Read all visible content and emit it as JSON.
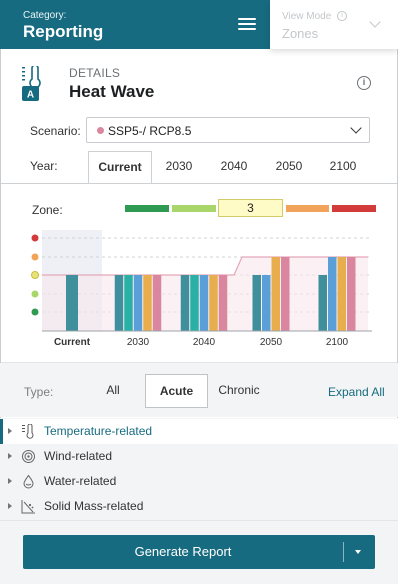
{
  "header": {
    "category_label": "Category:",
    "title": "Reporting",
    "view_mode_label": "View Mode",
    "view_mode_value": "Zones"
  },
  "details": {
    "label": "DETAILS",
    "title": "Heat Wave",
    "icon": "thermometer-icon"
  },
  "scenario": {
    "label": "Scenario:",
    "value": "SSP5-/ RCP8.5",
    "dot_color": "#d9869e"
  },
  "year": {
    "label": "Year:",
    "tabs": [
      "Current",
      "2030",
      "2040",
      "2050",
      "2100"
    ],
    "selected": "Current"
  },
  "zone": {
    "label": "Zone:",
    "value": "3",
    "colors": [
      "#2e9a52",
      "#a9d66a",
      "#fffbc7",
      "#f2a35a",
      "#d33a3a"
    ]
  },
  "chart_data": {
    "type": "bar",
    "categories": [
      "Current",
      "2030",
      "2040",
      "2050",
      "2100"
    ],
    "y_levels": [
      "#d33a3a",
      "#f2a35a",
      "#e8e27a",
      "#a9d66a",
      "#2e9a52"
    ],
    "series": [
      {
        "color": "#3f8f9c",
        "values": [
          3,
          3,
          3,
          3,
          3
        ]
      },
      {
        "color": "#2bb0a6",
        "values": [
          null,
          3,
          3,
          null,
          null
        ]
      },
      {
        "color": "#5b9fd8",
        "values": [
          null,
          3,
          3,
          3,
          4
        ]
      },
      {
        "color": "#e8ad4c",
        "values": [
          null,
          3,
          3,
          4,
          4
        ]
      },
      {
        "color": "#d9869e",
        "values": [
          null,
          3,
          3,
          4,
          4
        ]
      }
    ],
    "trend_line": [
      3,
      3,
      3,
      4,
      4
    ]
  },
  "filter": {
    "type_label": "Type:",
    "options": [
      "All",
      "Acute",
      "Chronic"
    ],
    "selected": "Acute",
    "expand_all": "Expand All"
  },
  "tree": [
    {
      "label": "Temperature-related",
      "icon": "thermometer-small-icon",
      "active": true
    },
    {
      "label": "Wind-related",
      "icon": "wind-swirl-icon",
      "active": false
    },
    {
      "label": "Water-related",
      "icon": "water-drop-icon",
      "active": false
    },
    {
      "label": "Solid Mass-related",
      "icon": "landslide-icon",
      "active": false
    }
  ],
  "footer": {
    "generate_label": "Generate Report"
  },
  "colors": {
    "brand": "#176b80",
    "panel_bg": "#f3f4f5"
  }
}
